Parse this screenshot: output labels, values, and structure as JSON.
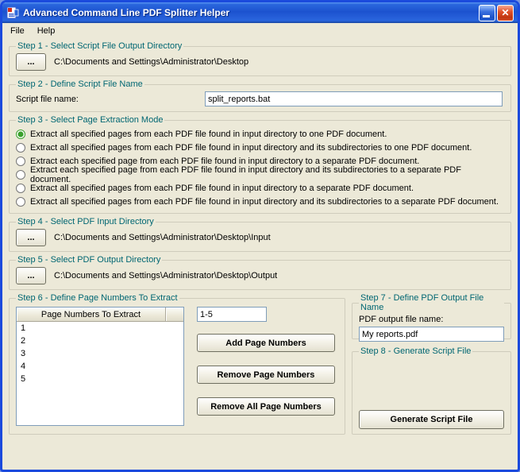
{
  "window": {
    "title": "Advanced Command Line PDF Splitter Helper",
    "close_glyph": "✕"
  },
  "menu": {
    "items": [
      {
        "label": "File"
      },
      {
        "label": "Help"
      }
    ]
  },
  "step1": {
    "title": "Step 1 - Select Script File Output Directory",
    "browse_label": "...",
    "path": "C:\\Documents and Settings\\Administrator\\Desktop"
  },
  "step2": {
    "title": "Step 2 - Define Script File Name",
    "label": "Script file name:",
    "value": "split_reports.bat"
  },
  "step3": {
    "title": "Step 3 - Select Page Extraction Mode",
    "options": [
      {
        "label": "Extract all specified pages from each PDF file found in input directory to one PDF document.",
        "selected": true
      },
      {
        "label": "Extract all specified pages from each PDF file found in input directory and its subdirectories to one PDF document.",
        "selected": false
      },
      {
        "label": "Extract each specified page from each PDF file found in input directory to a separate PDF document.",
        "selected": false
      },
      {
        "label": "Extract each specified page from each PDF file found in input directory and its subdirectories to a separate PDF document.",
        "selected": false
      },
      {
        "label": "Extract all specified pages from each PDF file found in input directory to a separate PDF document.",
        "selected": false
      },
      {
        "label": "Extract all specified pages from each PDF file found in input directory and its subdirectories to a separate PDF document.",
        "selected": false
      }
    ]
  },
  "step4": {
    "title": "Step 4 - Select PDF Input Directory",
    "browse_label": "...",
    "path": "C:\\Documents and Settings\\Administrator\\Desktop\\Input"
  },
  "step5": {
    "title": "Step 5 - Select PDF Output Directory",
    "browse_label": "...",
    "path": "C:\\Documents and Settings\\Administrator\\Desktop\\Output"
  },
  "step6": {
    "title": "Step 6 - Define Page Numbers To Extract",
    "list_header": "Page Numbers To Extract",
    "pages": [
      "1",
      "2",
      "3",
      "4",
      "5"
    ],
    "input_value": "1-5",
    "add_label": "Add Page Numbers",
    "remove_label": "Remove Page Numbers",
    "remove_all_label": "Remove All Page Numbers"
  },
  "step7": {
    "title": "Step 7 - Define PDF Output File Name",
    "label": "PDF output file name:",
    "value": "My reports.pdf"
  },
  "step8": {
    "title": "Step 8 - Generate Script File",
    "generate_label": "Generate Script File"
  }
}
